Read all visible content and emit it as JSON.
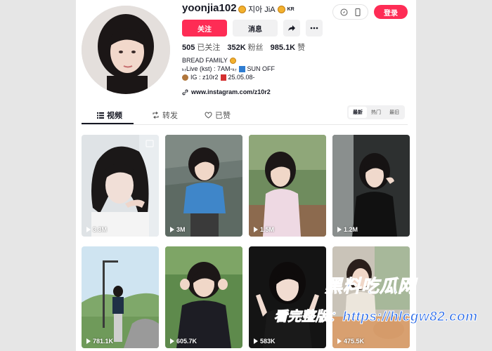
{
  "profile": {
    "username": "yoonjia102",
    "nickname": "지아 JiA",
    "nickname_badge": "KR"
  },
  "header": {
    "login_label": "登录"
  },
  "buttons": {
    "follow": "关注",
    "message": "消息"
  },
  "stats": {
    "following_count": "505",
    "following_label": "已关注",
    "followers_count": "352K",
    "followers_label": "粉丝",
    "likes_count": "985.1K",
    "likes_label": "赞"
  },
  "bio": {
    "line1": "BREAD FAMILY",
    "line2a": "ₖᵣLive (kst) : 7AM-ₖᵣ",
    "line2b": "SUN OFF",
    "line3a": " IG : z10r2 ",
    "line3b": "25.05.08-"
  },
  "link": {
    "text": "www.instagram.com/z10r2"
  },
  "tabs": {
    "videos": "视频",
    "reposts": "转发",
    "liked": "已赞"
  },
  "sort": {
    "latest": "最新",
    "popular": "热门",
    "oldest": "最旧"
  },
  "videos": [
    {
      "views": "3.3M"
    },
    {
      "views": "3M"
    },
    {
      "views": "1.5M"
    },
    {
      "views": "1.2M"
    },
    {
      "views": "781.1K"
    },
    {
      "views": "605.7K"
    },
    {
      "views": "583K"
    },
    {
      "views": "475.5K"
    }
  ],
  "watermark": {
    "line1": "黑料吃瓜网",
    "line2": "看完整版：https://hlcgw82.com"
  },
  "colors": {
    "accent": "#fe2c55",
    "watermark": "#2a6be8"
  }
}
